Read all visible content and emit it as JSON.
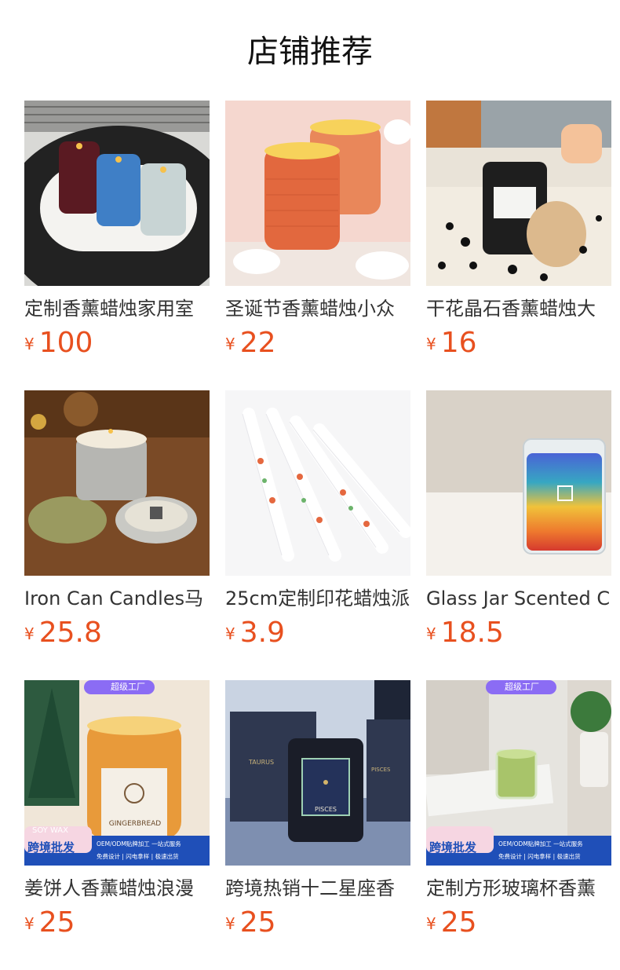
{
  "page": {
    "title": "店铺推荐"
  },
  "currency": "¥",
  "products": [
    {
      "name": "定制香薰蜡烛家用室",
      "price": "100",
      "image": "three-glass-candles-on-tray"
    },
    {
      "name": "圣诞节香薰蜡烛小众",
      "price": "22",
      "image": "orange-frosted-candles-cotton"
    },
    {
      "name": "干花晶石香薰蜡烛大",
      "price": "16",
      "image": "black-jar-candle-wood-lid"
    },
    {
      "name": "Iron Can Candles马",
      "price": "25.8",
      "image": "tin-can-candles-dried-flowers"
    },
    {
      "name": "25cm定制印花蜡烛派",
      "price": "3.9",
      "image": "printed-taper-candles"
    },
    {
      "name": "Glass Jar Scented C",
      "price": "18.5",
      "image": "rainbow-glass-jar-candle"
    },
    {
      "name": "姜饼人香薰蜡烛浪漫",
      "price": "25",
      "image": "gingerbread-candle",
      "badge_top": "超级工厂",
      "badge_bottom": "跨境批发",
      "badge_tag": "SOY WAX",
      "label_text": "GINGERBREAD",
      "banner_line1": "OEM/ODM贴牌加工 一站式服务",
      "banner_line2": "免费设计 | 闪电拿样 | 极速出货"
    },
    {
      "name": "跨境热销十二星座香",
      "price": "25",
      "image": "zodiac-candle-boxes",
      "label_text": "PISCES",
      "box_left": "TAURUS",
      "box_right": "PISCES"
    },
    {
      "name": "定制方形玻璃杯香薰",
      "price": "25",
      "image": "square-glass-candle",
      "badge_top": "超级工厂",
      "badge_bottom": "跨境批发",
      "banner_line1": "OEM/ODM贴牌加工 一站式服务",
      "banner_line2": "免费设计 | 闪电拿样 | 极速出货"
    }
  ],
  "colors": {
    "price": "#e8501f",
    "badge_purple": "#7b5cf0",
    "banner_blue": "#1f4fb8"
  }
}
